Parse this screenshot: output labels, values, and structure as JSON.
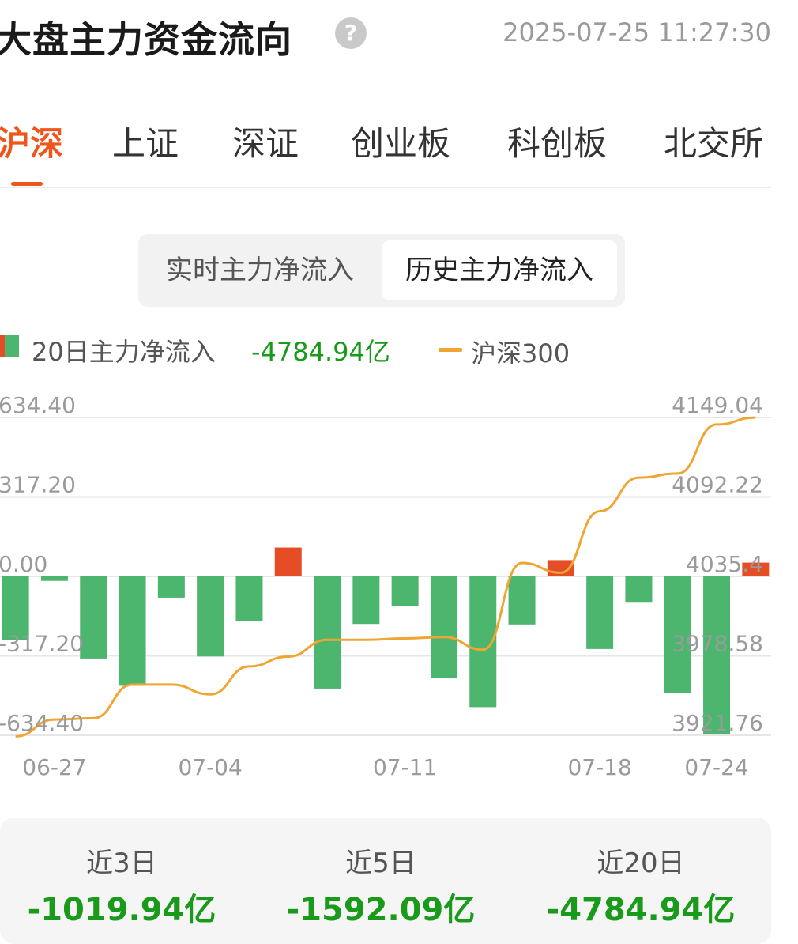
{
  "header": {
    "title": "大盘主力资金流向",
    "help_icon": "question-circle-icon",
    "help_glyph": "?",
    "timestamp": "2025-07-25 11:27:30"
  },
  "tabs": [
    {
      "label": "沪深",
      "active": true
    },
    {
      "label": "上证",
      "active": false
    },
    {
      "label": "深证",
      "active": false
    },
    {
      "label": "创业板",
      "active": false
    },
    {
      "label": "科创板",
      "active": false
    },
    {
      "label": "北交所",
      "active": false
    }
  ],
  "segment": {
    "realtime_label": "实时主力净流入",
    "history_label": "历史主力净流入",
    "active": "history"
  },
  "legend": {
    "bar_label": "20日主力净流入",
    "bar_value": "-4784.94亿",
    "line_label": "沪深300"
  },
  "colors": {
    "accent": "#f0561c",
    "bar_positive": "#e54d26",
    "bar_negative": "#4cb66e",
    "line": "#f0a532",
    "negative_text": "#1a9a1a"
  },
  "chart_data": {
    "type": "bar",
    "left_axis": {
      "ticks": [
        "634.40",
        "317.20",
        "0.00",
        "-317.20",
        "-634.40"
      ],
      "range": [
        -634.4,
        634.4
      ]
    },
    "right_axis": {
      "ticks": [
        "4149.04",
        "4092.22",
        "4035.4",
        "3978.58",
        "3921.76"
      ],
      "range": [
        3921.76,
        4149.04
      ]
    },
    "x_ticks": [
      "06-27",
      "07-04",
      "07-11",
      "07-18",
      "07-24"
    ],
    "x_tick_index": [
      1,
      5,
      10,
      15,
      18
    ],
    "grid": true,
    "series": [
      {
        "name": "20日主力净流入",
        "values": [
          -255,
          -18,
          -328,
          -437,
          -85,
          -320,
          -178,
          115,
          -448,
          -190,
          -120,
          -405,
          -522,
          -192,
          65,
          -290,
          -105,
          -465,
          -630,
          55
        ]
      },
      {
        "name": "沪深300",
        "values": [
          3921,
          3933,
          3934,
          3958,
          3958,
          3951,
          3971,
          3978,
          3990,
          3990,
          3991,
          3992,
          3983,
          4045,
          4038,
          4082,
          4106,
          4109,
          4144,
          4149
        ]
      }
    ]
  },
  "summary": [
    {
      "label": "近3日",
      "value": "-1019.94亿"
    },
    {
      "label": "近5日",
      "value": "-1592.09亿"
    },
    {
      "label": "近20日",
      "value": "-4784.94亿"
    }
  ]
}
